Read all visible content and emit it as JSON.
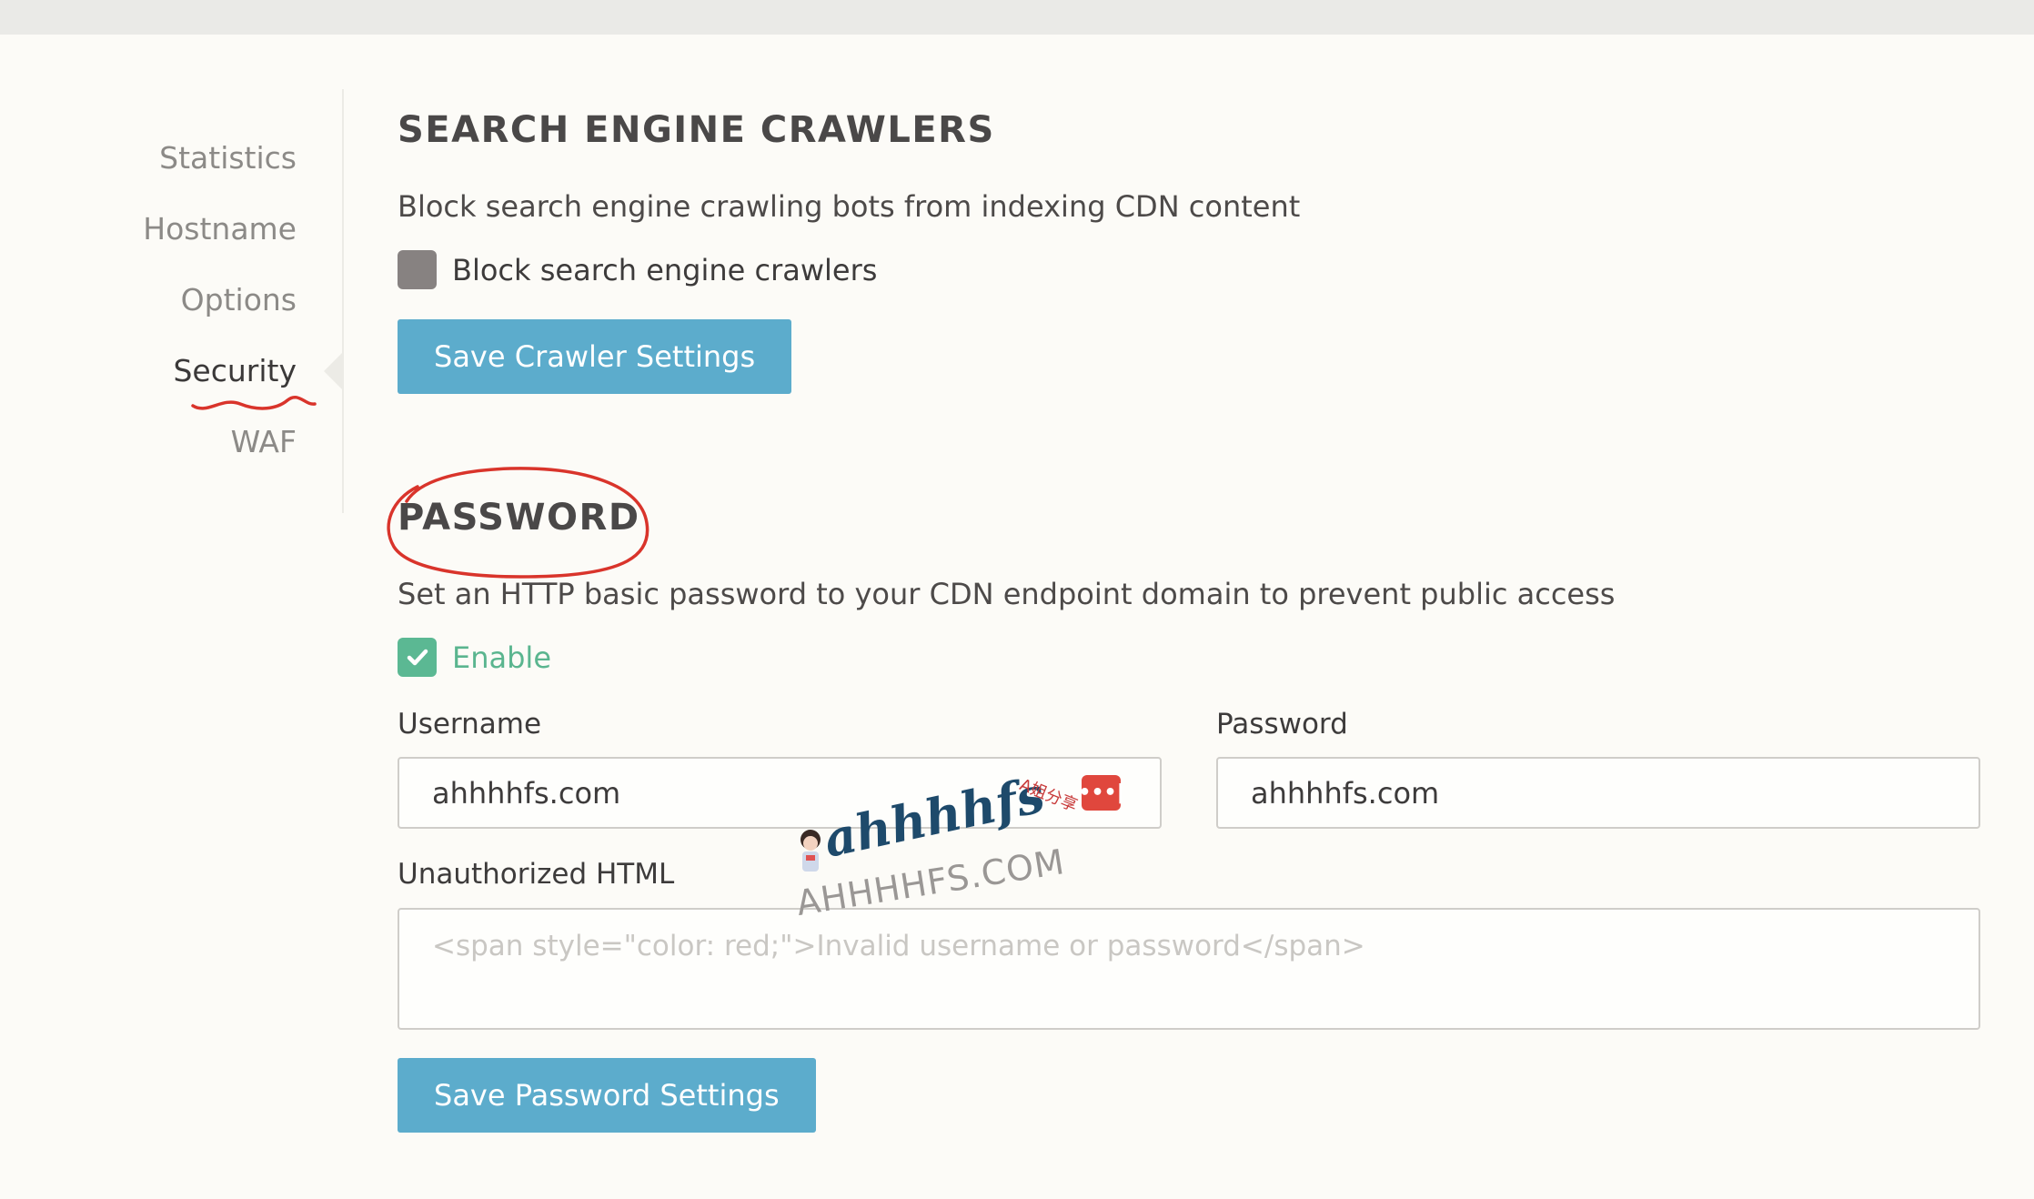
{
  "sidebar": {
    "items": [
      {
        "label": "Statistics"
      },
      {
        "label": "Hostname"
      },
      {
        "label": "Options"
      },
      {
        "label": "Security",
        "active": true
      },
      {
        "label": "WAF"
      }
    ]
  },
  "crawlers": {
    "title": "SEARCH ENGINE CRAWLERS",
    "description": "Block search engine crawling bots from indexing CDN content",
    "checkbox_label": "Block search engine crawlers",
    "checkbox_checked": false,
    "save_label": "Save Crawler Settings"
  },
  "password": {
    "title": "PASSWORD",
    "description": "Set an HTTP basic password to your CDN endpoint domain to prevent public access",
    "enable_label": "Enable",
    "enable_checked": true,
    "username_label": "Username",
    "username_value": "ahhhhfs.com",
    "password_label": "Password",
    "password_value": "ahhhhfs.com",
    "unauthorized_label": "Unauthorized HTML",
    "unauthorized_placeholder": "<span style=\"color: red;\">Invalid username or password</span>",
    "save_label": "Save Password Settings"
  },
  "watermark": {
    "main": "ahhhhfs",
    "sub": "AHHHHFS.COM",
    "tag": "A姐分享"
  },
  "colors": {
    "accent_button": "#5caccc",
    "enabled_green": "#5bb893",
    "annotation_red": "#d9342b",
    "password_manager_red": "#e0473d"
  },
  "icons": {
    "password_manager": "password-manager-icon",
    "checkmark": "checkmark-icon"
  }
}
